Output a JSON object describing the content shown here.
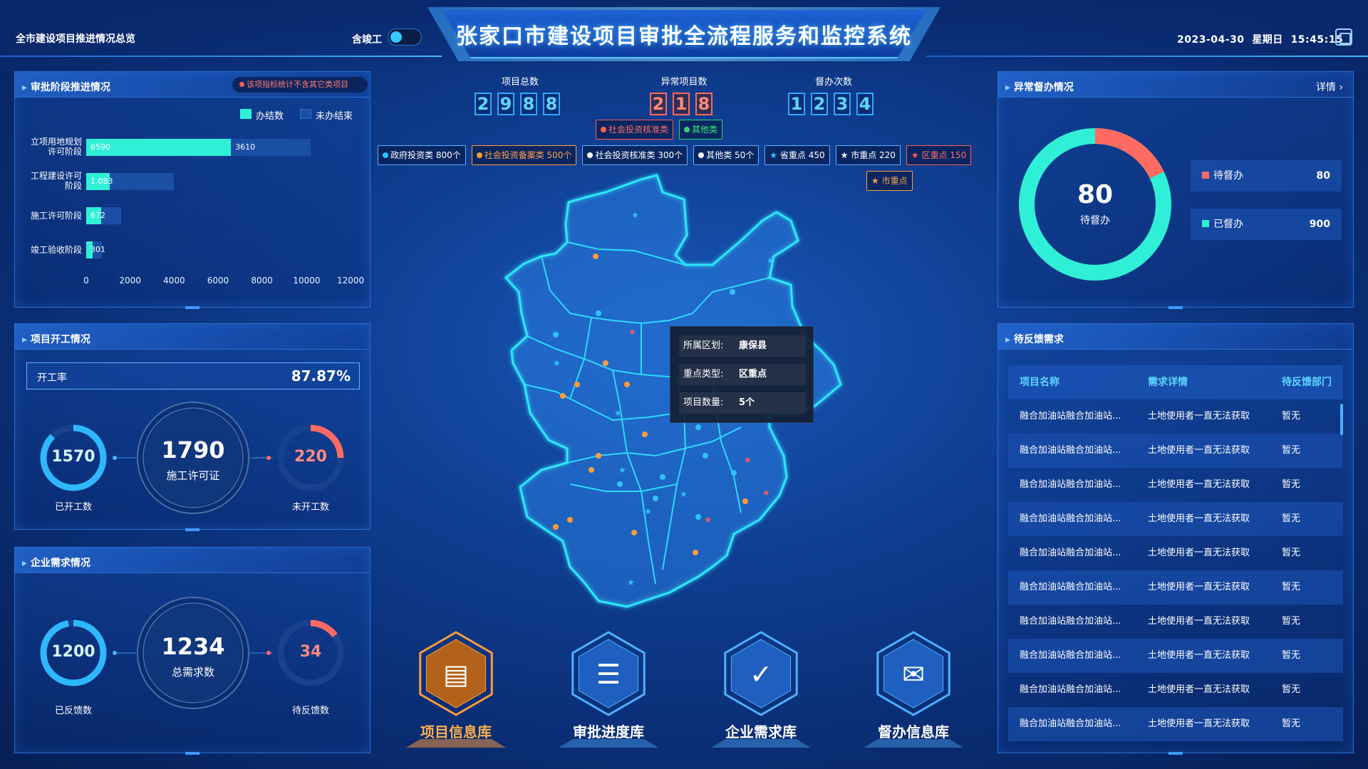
{
  "header": {
    "title": "张家口市建设项目审批全流程服务和监控系统",
    "left_label": "全市建设项目推进情况总览",
    "toggle_label": "含竣工",
    "toggle_on": true,
    "date": "2023-04-30",
    "weekday": "星期日",
    "time": "15:45:15",
    "fullscreen_icon": "fullscreen-icon"
  },
  "approval": {
    "title": "审批阶段推进情况",
    "note": "该项指标统计不含其它类项目",
    "legend": [
      {
        "label": "办结数",
        "color": "#2ff0d6"
      },
      {
        "label": "未办结束",
        "color": "#1a4fa4"
      }
    ],
    "ticks": [
      "0",
      "2000",
      "4000",
      "6000",
      "8000",
      "10000",
      "12000"
    ],
    "chart_data": {
      "type": "bar",
      "orientation": "horizontal",
      "stacked": true,
      "categories": [
        "立项用地规划许可阶段",
        "工程建设许可阶段",
        "施工许可阶段",
        "竣工验收阶段"
      ],
      "category_lines": [
        [
          "立项用地规划",
          "许可阶段"
        ],
        [
          "工程建设许可",
          "阶段"
        ],
        [
          "施工许可阶段"
        ],
        [
          "竣工验收阶段"
        ]
      ],
      "series": [
        {
          "name": "办结数",
          "values": [
            6590,
            1083,
            672,
            301
          ],
          "labels": [
            "6590",
            "1,083",
            "672",
            "301"
          ]
        },
        {
          "name": "未办结束",
          "values": [
            3610,
            2917,
            928,
            399
          ],
          "labels": [
            "3610",
            "",
            "",
            ""
          ]
        }
      ],
      "xlim": [
        0,
        12000
      ]
    }
  },
  "start": {
    "title": "项目开工情况",
    "rate_label": "开工率",
    "rate_value": "87.87%",
    "center_value": "1790",
    "center_label": "施工许可证",
    "left_value": "1570",
    "left_label": "已开工数",
    "left_fraction": 0.877,
    "right_value": "220",
    "right_label": "未开工数",
    "right_fraction": 0.25
  },
  "demand": {
    "title": "企业需求情况",
    "center_value": "1234",
    "center_label": "总需求数",
    "left_value": "1200",
    "left_label": "已反馈数",
    "left_fraction": 0.972,
    "right_value": "34",
    "right_label": "待反馈数",
    "right_fraction": 0.15
  },
  "stats": [
    {
      "title": "项目总数",
      "digits": [
        "2",
        "9",
        "8",
        "8"
      ],
      "style": "blue"
    },
    {
      "title": "异常项目数",
      "digits": [
        "2",
        "1",
        "8"
      ],
      "style": "red"
    },
    {
      "title": "督办次数",
      "digits": [
        "1",
        "2",
        "3",
        "4"
      ],
      "style": "blue"
    }
  ],
  "chips_top": [
    {
      "label": "社会投资核准类",
      "style": "red"
    },
    {
      "label": "其他类",
      "style": "green"
    }
  ],
  "chips_row": [
    {
      "label": "政府投资类 800个",
      "style": "blue",
      "marker": "dot"
    },
    {
      "label": "社会投资备案类 500个",
      "style": "orange",
      "marker": "dot"
    },
    {
      "label": "社会投资核准类 300个",
      "style": "white",
      "marker": "dot"
    },
    {
      "label": "其他类 50个",
      "style": "white",
      "marker": "dot"
    },
    {
      "label": "省重点 450",
      "style": "blue",
      "marker": "star"
    },
    {
      "label": "市重点 220",
      "style": "white",
      "marker": "star"
    },
    {
      "label": "区重点 150",
      "style": "red",
      "marker": "star"
    }
  ],
  "chip_extra": {
    "label": "市重点",
    "style": "orange",
    "marker": "star"
  },
  "tooltip": {
    "rows": [
      {
        "k": "所属区划:",
        "v": "康保县"
      },
      {
        "k": "重点类型:",
        "v": "区重点"
      },
      {
        "k": "项目数量:",
        "v": "5个"
      }
    ]
  },
  "nav": [
    {
      "label": "项目信息库",
      "icon": "project-info-icon",
      "active": true
    },
    {
      "label": "审批进度库",
      "icon": "approval-progress-icon",
      "active": false
    },
    {
      "label": "企业需求库",
      "icon": "enterprise-demand-icon",
      "active": false
    },
    {
      "label": "督办信息库",
      "icon": "supervision-info-icon",
      "active": false
    }
  ],
  "supervise": {
    "title": "异常督办情况",
    "detail": "详情",
    "center_value": "80",
    "center_label": "待督办",
    "pending_label": "待督办",
    "pending_value": "80",
    "done_label": "已督办",
    "done_value": "900",
    "pending_color": "#ff6b62",
    "done_color": "#2ff0d6"
  },
  "feedback": {
    "title": "待反馈需求",
    "columns": [
      "项目名称",
      "需求详情",
      "待反馈部门"
    ],
    "rows": [
      [
        "融合加油站融合加油站...",
        "土地使用者一直无法获取",
        "暂无"
      ],
      [
        "融合加油站融合加油站...",
        "土地使用者一直无法获取",
        "暂无"
      ],
      [
        "融合加油站融合加油站...",
        "土地使用者一直无法获取",
        "暂无"
      ],
      [
        "融合加油站融合加油站...",
        "土地使用者一直无法获取",
        "暂无"
      ],
      [
        "融合加油站融合加油站...",
        "土地使用者一直无法获取",
        "暂无"
      ],
      [
        "融合加油站融合加油站...",
        "土地使用者一直无法获取",
        "暂无"
      ],
      [
        "融合加油站融合加油站...",
        "土地使用者一直无法获取",
        "暂无"
      ],
      [
        "融合加油站融合加油站...",
        "土地使用者一直无法获取",
        "暂无"
      ],
      [
        "融合加油站融合加油站...",
        "土地使用者一直无法获取",
        "暂无"
      ],
      [
        "融合加油站融合加油站...",
        "土地使用者一直无法获取",
        "暂无"
      ]
    ]
  }
}
